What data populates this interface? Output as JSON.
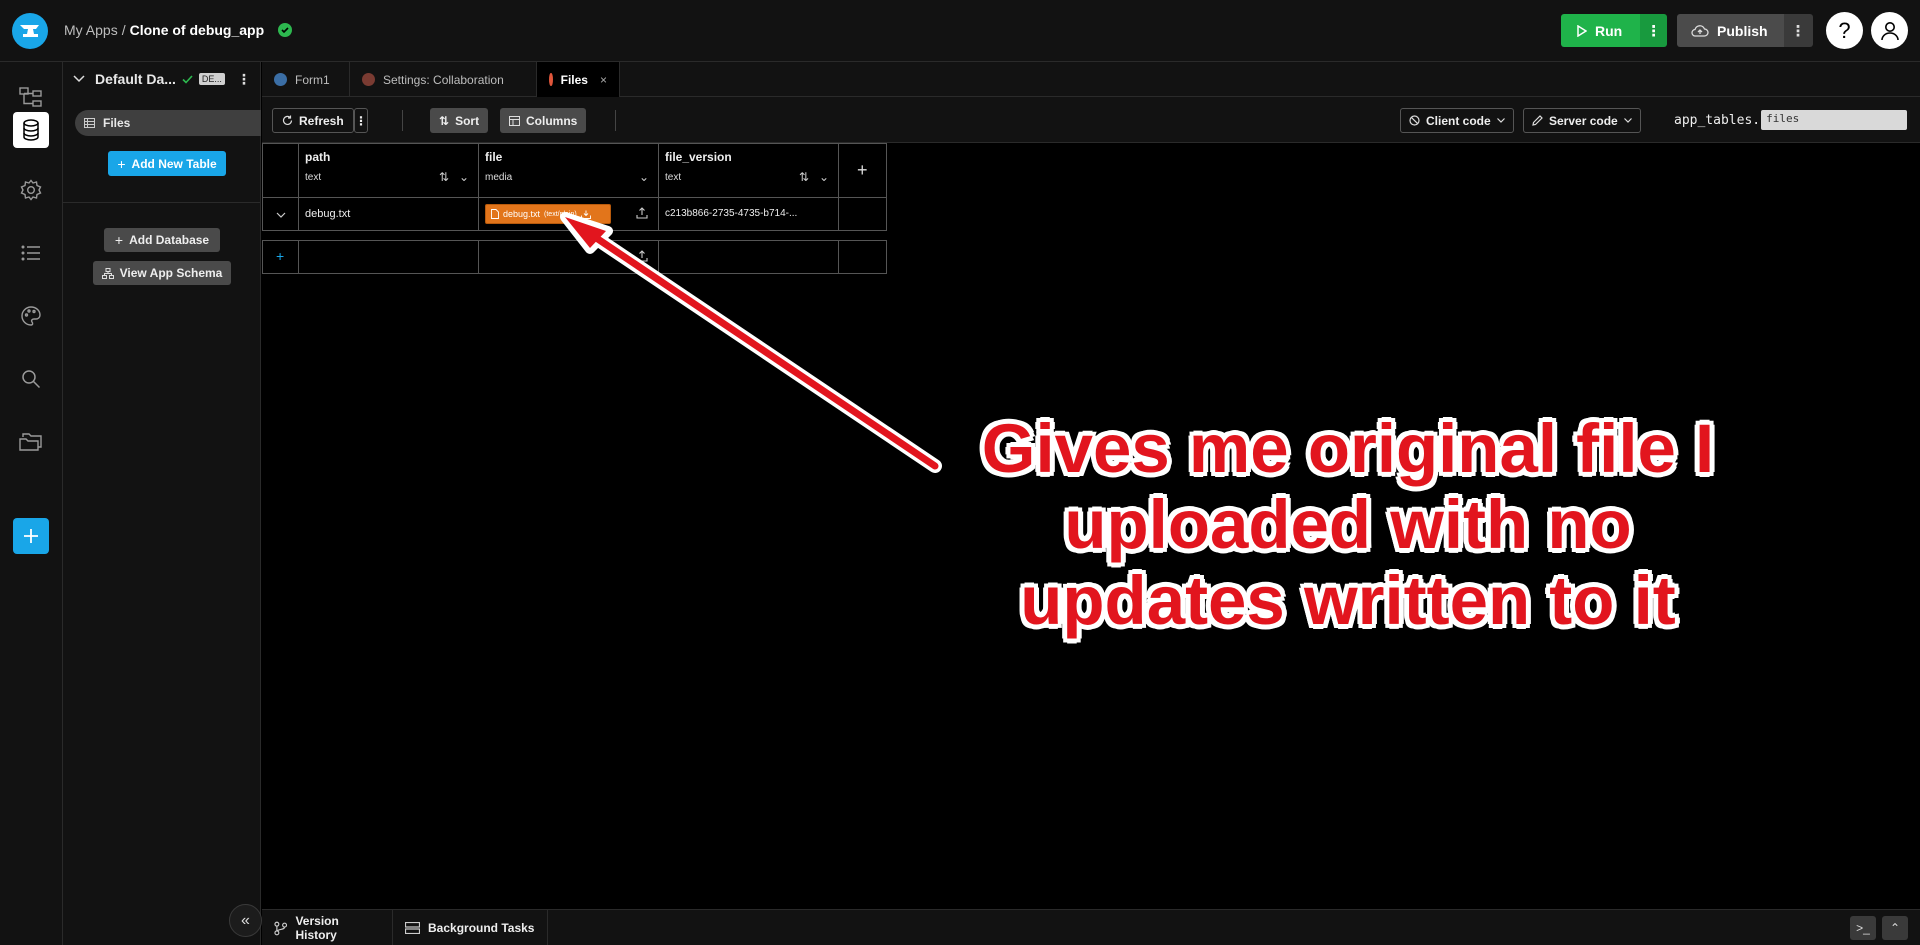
{
  "topbar": {
    "breadcrumb_root": "My Apps",
    "breadcrumb_sep": "/",
    "app_name": "Clone of debug_app",
    "run_label": "Run",
    "publish_label": "Publish",
    "help_glyph": "?",
    "accent_run": "#1fb34a",
    "accent_brand": "#19a6e8"
  },
  "rail": {
    "items": [
      "app-structure-icon",
      "database-icon",
      "settings-icon",
      "list-icon",
      "palette-icon",
      "search-icon",
      "folder-icon",
      "add-icon"
    ]
  },
  "panel": {
    "db_title": "Default Da...",
    "db_badge": "DE...",
    "table_item": "Files",
    "add_table": "Add New Table",
    "add_database": "Add Database",
    "view_schema": "View App Schema"
  },
  "tabs": [
    {
      "label": "Form1"
    },
    {
      "label": "Settings: Collaboration"
    },
    {
      "label": "Files",
      "close": "×"
    }
  ],
  "toolbar": {
    "refresh": "Refresh",
    "sort": "Sort",
    "columns": "Columns",
    "client_code": "Client code",
    "server_code": "Server code",
    "app_tables_prefix": "app_tables.",
    "app_tables_value": "files"
  },
  "table": {
    "columns": [
      {
        "name": "path",
        "type": "text"
      },
      {
        "name": "file",
        "type": "media"
      },
      {
        "name": "file_version",
        "type": "text"
      }
    ],
    "rows": [
      {
        "path": "debug.txt",
        "file_name": "debug.txt",
        "file_mime": "(text/plain)",
        "file_version": "c213b866-2735-4735-b714-..."
      }
    ]
  },
  "annotation": {
    "line1": "Gives me original file I",
    "line2": "uploaded with no",
    "line3": "updates written to it",
    "color": "#e2151e"
  },
  "bottombar": {
    "version_history": "Version History",
    "background_tasks": "Background Tasks"
  }
}
